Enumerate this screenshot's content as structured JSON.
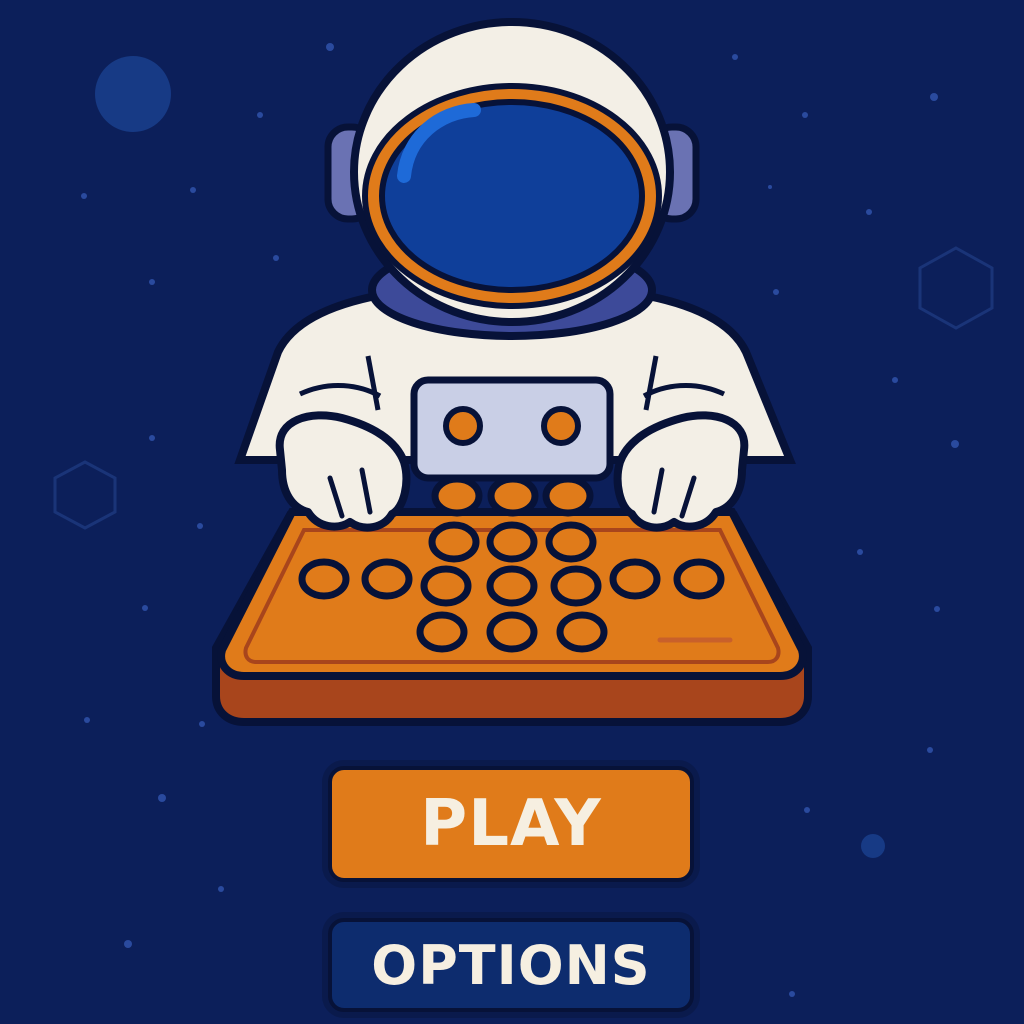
{
  "menu": {
    "play_label": "PLAY",
    "options_label": "OPTIONS"
  },
  "colors": {
    "background": "#0c1f5a",
    "accent_orange": "#e07b1a",
    "button_navy": "#0d2c6e",
    "suit_white": "#f3efe6",
    "outline": "#071238",
    "visor_blue": "#0f3f9a"
  },
  "icons": {
    "character": "astronaut-icon",
    "console": "button-pad-icon"
  }
}
